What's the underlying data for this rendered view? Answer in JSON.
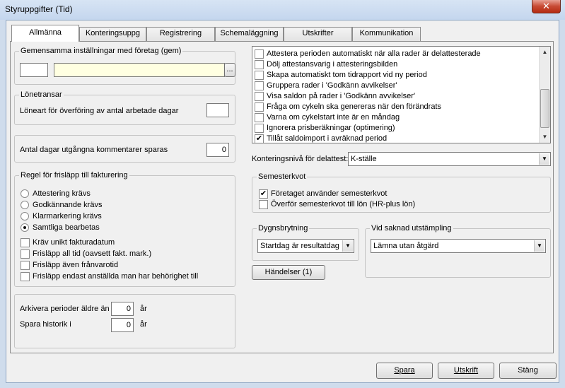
{
  "window": {
    "title": "Styruppgifter (Tid)"
  },
  "tabs": [
    {
      "label": "Allmänna",
      "active": true
    },
    {
      "label": "Konteringsuppg"
    },
    {
      "label": "Registrering"
    },
    {
      "label": "Schemaläggning"
    },
    {
      "label": "Utskrifter"
    },
    {
      "label": "Kommunikation"
    }
  ],
  "gem": {
    "title": "Gemensamma inställningar med företag (gem)",
    "code": "",
    "name": "",
    "browse": "..."
  },
  "lonetransar": {
    "title": "Lönetransar",
    "label": "Löneart för överföring av antal arbetade dagar",
    "value": ""
  },
  "kommentarer": {
    "label": "Antal dagar utgångna kommentarer sparas",
    "value": "0"
  },
  "regel": {
    "title": "Regel för frisläpp till fakturering",
    "radios": [
      {
        "label": "Attestering krävs",
        "checked": false
      },
      {
        "label": "Godkännande krävs",
        "checked": false
      },
      {
        "label": "Klarmarkering krävs",
        "checked": false
      },
      {
        "label": "Samtliga bearbetas",
        "checked": true
      }
    ],
    "checks": [
      {
        "label": "Kräv unikt fakturadatum",
        "checked": false
      },
      {
        "label": "Frisläpp all tid (oavsett fakt. mark.)",
        "checked": false
      },
      {
        "label": "Frisläpp även frånvarotid",
        "checked": false
      },
      {
        "label": "Frisläpp endast anställda man har behörighet till",
        "checked": false
      }
    ]
  },
  "arkiv": {
    "label1": "Arkivera perioder äldre än",
    "value1": "0",
    "unit1": "år",
    "label2": "Spara historik i",
    "value2": "0",
    "unit2": "år"
  },
  "options": [
    {
      "label": "Attestera perioden automatiskt när alla rader är delattesterade",
      "checked": false
    },
    {
      "label": "Dölj attestansvarig i attesteringsbilden",
      "checked": false
    },
    {
      "label": "Skapa automatiskt tom tidrapport vid ny period",
      "checked": false
    },
    {
      "label": "Gruppera rader i 'Godkänn avvikelser'",
      "checked": false
    },
    {
      "label": "Visa saldon på rader i 'Godkänn avvikelser'",
      "checked": false
    },
    {
      "label": "Fråga om cykeln ska genereras när den förändrats",
      "checked": false
    },
    {
      "label": "Varna om cykelstart inte är en måndag",
      "checked": false
    },
    {
      "label": "Ignorera prisberäkningar (optimering)",
      "checked": false
    },
    {
      "label": "Tillåt saldoimport i avräknad period",
      "checked": true
    }
  ],
  "kontering": {
    "label": "Konteringsnivå för delattest:",
    "value": "K-ställe"
  },
  "semester": {
    "title": "Semesterkvot",
    "checks": [
      {
        "label": "Företaget använder semesterkvot",
        "checked": true
      },
      {
        "label": "Överför semesterkvot till lön (HR-plus lön)",
        "checked": false
      }
    ]
  },
  "dygn": {
    "title": "Dygnsbrytning",
    "value": "Startdag är resultatdag"
  },
  "saknad": {
    "title": "Vid saknad utstämpling",
    "value": "Lämna utan åtgärd"
  },
  "handelser": {
    "label": "Händelser (1)"
  },
  "buttons": {
    "save": "Spara",
    "print": "Utskrift",
    "close": "Stäng"
  },
  "glyphs": {
    "check": "✔",
    "close_x": "✕",
    "arrow_down": "▼",
    "arrow_up": "▲"
  }
}
